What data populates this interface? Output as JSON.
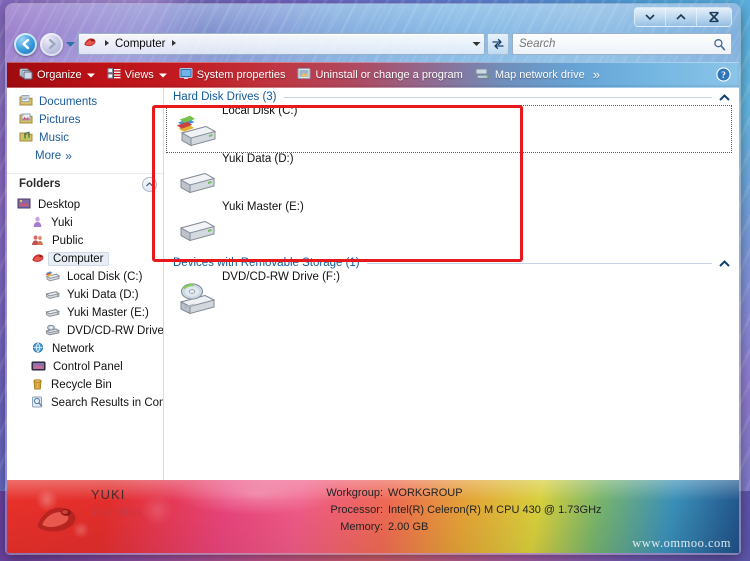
{
  "window": {
    "caption_buttons": [
      {
        "name": "minimize",
        "glyph": "▼"
      },
      {
        "name": "maximize",
        "glyph": "▲"
      },
      {
        "name": "close",
        "glyph": "✕"
      }
    ]
  },
  "address": {
    "back_label": "Back",
    "forward_label": "Forward",
    "history_label": "Recent pages",
    "crumb_icon": "computer-icon",
    "crumb_text": "Computer",
    "sep": "►",
    "dropdown": "▼",
    "refresh_label": "Refresh"
  },
  "search": {
    "placeholder": "Search",
    "value": "",
    "icon": "search-icon"
  },
  "toolbar": {
    "items": [
      {
        "label": "Organize",
        "icon": "organize-icon",
        "has_arrow": true
      },
      {
        "label": "Views",
        "icon": "views-icon",
        "has_arrow": true
      },
      {
        "label": "System properties",
        "icon": "system-properties-icon",
        "has_arrow": false
      },
      {
        "label": "Uninstall or change a program",
        "icon": "uninstall-icon",
        "has_arrow": false
      },
      {
        "label": "Map network drive",
        "icon": "map-network-drive-icon",
        "has_arrow": false
      }
    ],
    "overflow": "»",
    "help_label": "Help"
  },
  "navpane": {
    "favorites": [
      {
        "label": "Documents",
        "icon": "documents-icon"
      },
      {
        "label": "Pictures",
        "icon": "pictures-icon"
      },
      {
        "label": "Music",
        "icon": "music-icon"
      }
    ],
    "more_label": "More",
    "more_glyph": "»",
    "folders_header": "Folders",
    "folders_collapse": "▲",
    "tree": [
      {
        "label": "Desktop",
        "icon": "desktop-icon",
        "indent": 0,
        "selected": false
      },
      {
        "label": "Yuki",
        "icon": "user-icon",
        "indent": 1,
        "selected": false
      },
      {
        "label": "Public",
        "icon": "public-icon",
        "indent": 1,
        "selected": false
      },
      {
        "label": "Computer",
        "icon": "computer-icon",
        "indent": 1,
        "selected": true
      },
      {
        "label": "Local Disk (C:)",
        "icon": "local-disk-icon",
        "indent": 2,
        "selected": false
      },
      {
        "label": "Yuki Data (D:)",
        "icon": "hard-drive-icon",
        "indent": 2,
        "selected": false
      },
      {
        "label": "Yuki Master (E:)",
        "icon": "hard-drive-icon",
        "indent": 2,
        "selected": false
      },
      {
        "label": "DVD/CD-RW Drive (",
        "icon": "dvd-drive-icon",
        "indent": 2,
        "selected": false
      },
      {
        "label": "Network",
        "icon": "network-icon",
        "indent": 1,
        "selected": false
      },
      {
        "label": "Control Panel",
        "icon": "control-panel-icon",
        "indent": 1,
        "selected": false
      },
      {
        "label": "Recycle Bin",
        "icon": "recycle-bin-icon",
        "indent": 1,
        "selected": false
      },
      {
        "label": "Search Results in Com",
        "icon": "search-results-icon",
        "indent": 1,
        "selected": false
      }
    ]
  },
  "content": {
    "groups": [
      {
        "title": "Hard Disk Drives (3)",
        "collapse": "▲",
        "items": [
          {
            "label": "Local Disk (C:)",
            "icon": "system-disk-icon",
            "selected": true
          },
          {
            "label": "Yuki Data (D:)",
            "icon": "hard-drive-icon",
            "selected": false
          },
          {
            "label": "Yuki Master (E:)",
            "icon": "hard-drive-icon",
            "selected": false
          }
        ]
      },
      {
        "title": "Devices with Removable Storage (1)",
        "collapse": "▲",
        "items": [
          {
            "label": "DVD/CD-RW Drive (F:)",
            "icon": "dvd-drive-icon",
            "selected": false
          }
        ]
      }
    ]
  },
  "status": {
    "icon": "computer-icon",
    "computer_name": "YUKI",
    "user_name": "Yuki Mion",
    "details": [
      {
        "key": "Workgroup:",
        "value": "WORKGROUP"
      },
      {
        "key": "Processor:",
        "value": "Intel(R) Celeron(R) M CPU      430  @ 1.73GHz"
      },
      {
        "key": "Memory:",
        "value": "2.00 GB"
      }
    ],
    "watermark": "www.ommoo.com"
  },
  "annotation": {
    "color": "#e8191c",
    "label": "hard-disk-drives-highlight"
  }
}
